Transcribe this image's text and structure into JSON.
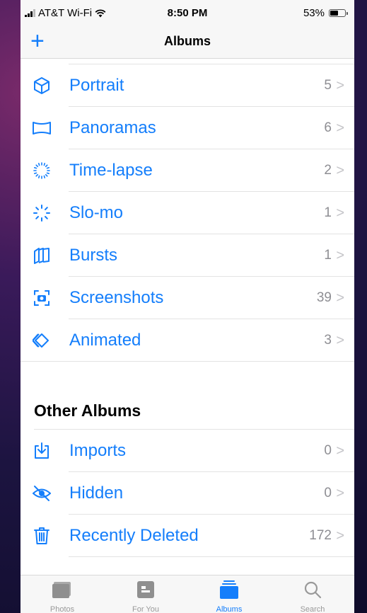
{
  "status_bar": {
    "carrier": "AT&T Wi-Fi",
    "time": "8:50 PM",
    "battery": "53%",
    "battery_level": 0.53
  },
  "nav": {
    "add_icon": "plus-icon",
    "title": "Albums"
  },
  "media_types": [
    {
      "icon": "portrait-cube-icon",
      "label": "Portrait",
      "count": "5"
    },
    {
      "icon": "panorama-icon",
      "label": "Panoramas",
      "count": "6"
    },
    {
      "icon": "timelapse-icon",
      "label": "Time-lapse",
      "count": "2"
    },
    {
      "icon": "slomo-icon",
      "label": "Slo-mo",
      "count": "1"
    },
    {
      "icon": "bursts-icon",
      "label": "Bursts",
      "count": "1"
    },
    {
      "icon": "screenshot-icon",
      "label": "Screenshots",
      "count": "39"
    },
    {
      "icon": "animated-icon",
      "label": "Animated",
      "count": "3"
    }
  ],
  "other_albums": {
    "heading": "Other Albums",
    "items": [
      {
        "icon": "import-icon",
        "label": "Imports",
        "count": "0"
      },
      {
        "icon": "hidden-eye-icon",
        "label": "Hidden",
        "count": "0"
      },
      {
        "icon": "trash-icon",
        "label": "Recently Deleted",
        "count": "172"
      }
    ]
  },
  "tabs": [
    {
      "icon": "photos-tab-icon",
      "label": "Photos",
      "active": false
    },
    {
      "icon": "for-you-tab-icon",
      "label": "For You",
      "active": false
    },
    {
      "icon": "albums-tab-icon",
      "label": "Albums",
      "active": true
    },
    {
      "icon": "search-tab-icon",
      "label": "Search",
      "active": false
    }
  ],
  "colors": {
    "accent": "#147efb",
    "muted": "#8e8e93"
  }
}
